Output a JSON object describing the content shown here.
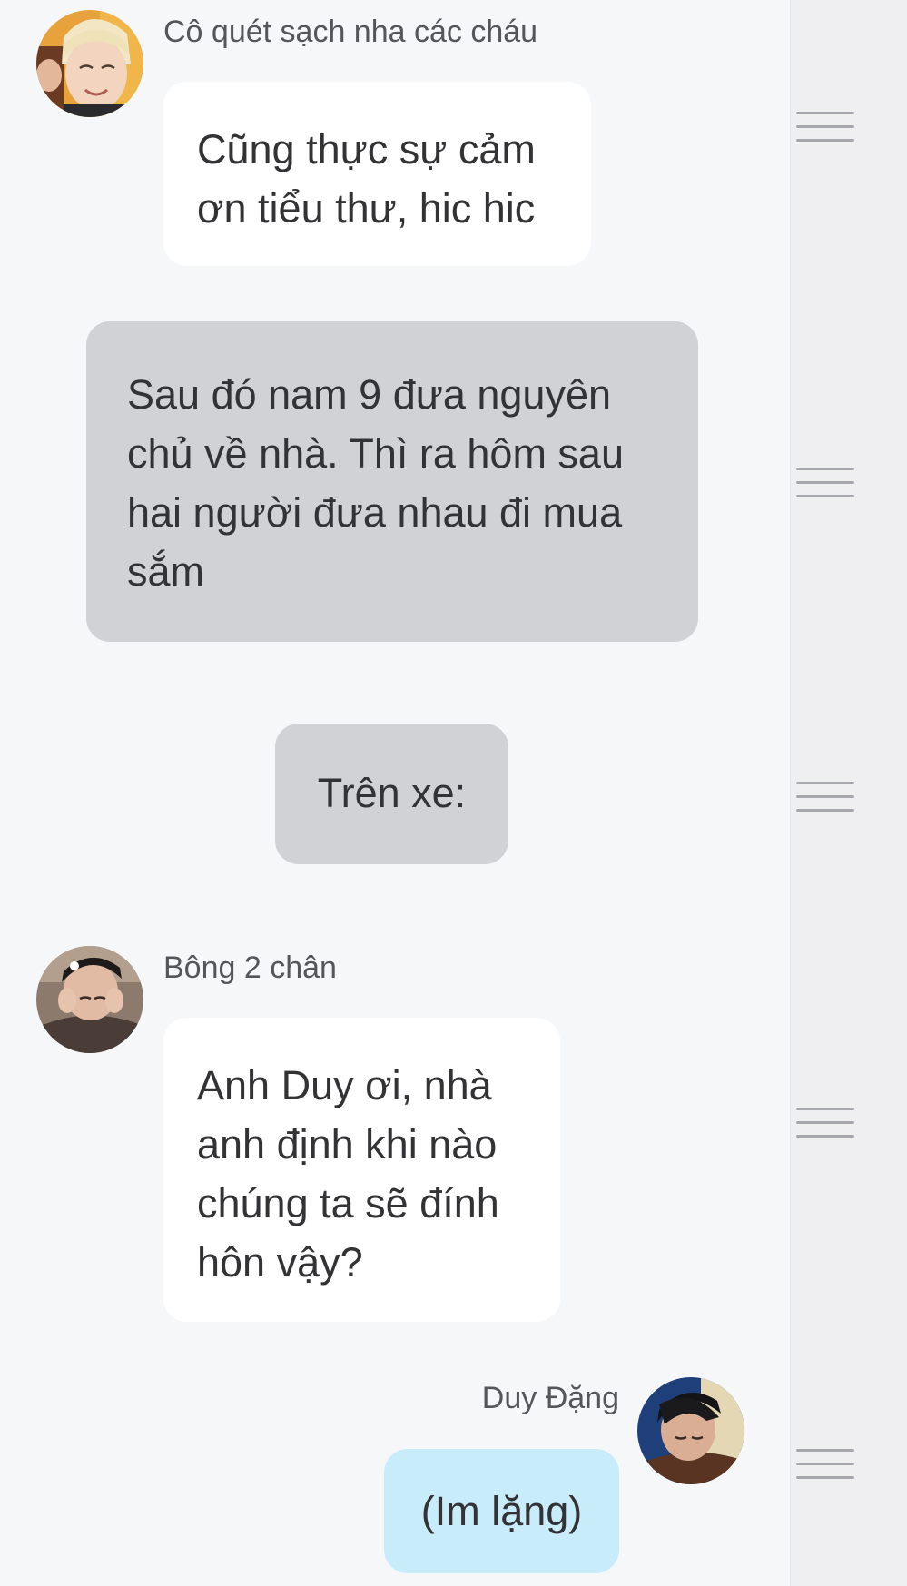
{
  "colors": {
    "background": "#f6f7f9",
    "right_rail": "#efeff1",
    "bubble_incoming": "#ffffff",
    "bubble_narration": "#d1d2d6",
    "bubble_outgoing": "#c9ecfb",
    "handle": "#a7a8ad"
  },
  "messages": [
    {
      "type": "incoming",
      "sender": "Cô quét sạch nha các cháu",
      "avatar": "avatar-blonde-smiling",
      "text": "Cũng thực sự cảm\nơn tiểu thư, hic hic"
    },
    {
      "type": "narration",
      "text": "Sau đó nam 9 đưa nguyên\nchủ về nhà. Thì ra hôm sau\nhai người đưa nhau đi mua\nsắm"
    },
    {
      "type": "narration",
      "text": "Trên xe:"
    },
    {
      "type": "incoming",
      "sender": "Bông 2 chân",
      "avatar": "avatar-boy-hands-on-face",
      "text": "Anh Duy ơi, nhà\nanh định khi nào\nchúng ta sẽ đính\nhôn vậy?"
    },
    {
      "type": "outgoing",
      "sender": "Duy Đặng",
      "avatar": "avatar-boy-sleeping",
      "text": "(Im lặng)"
    }
  ],
  "handle_icon": "drag-handle-icon"
}
